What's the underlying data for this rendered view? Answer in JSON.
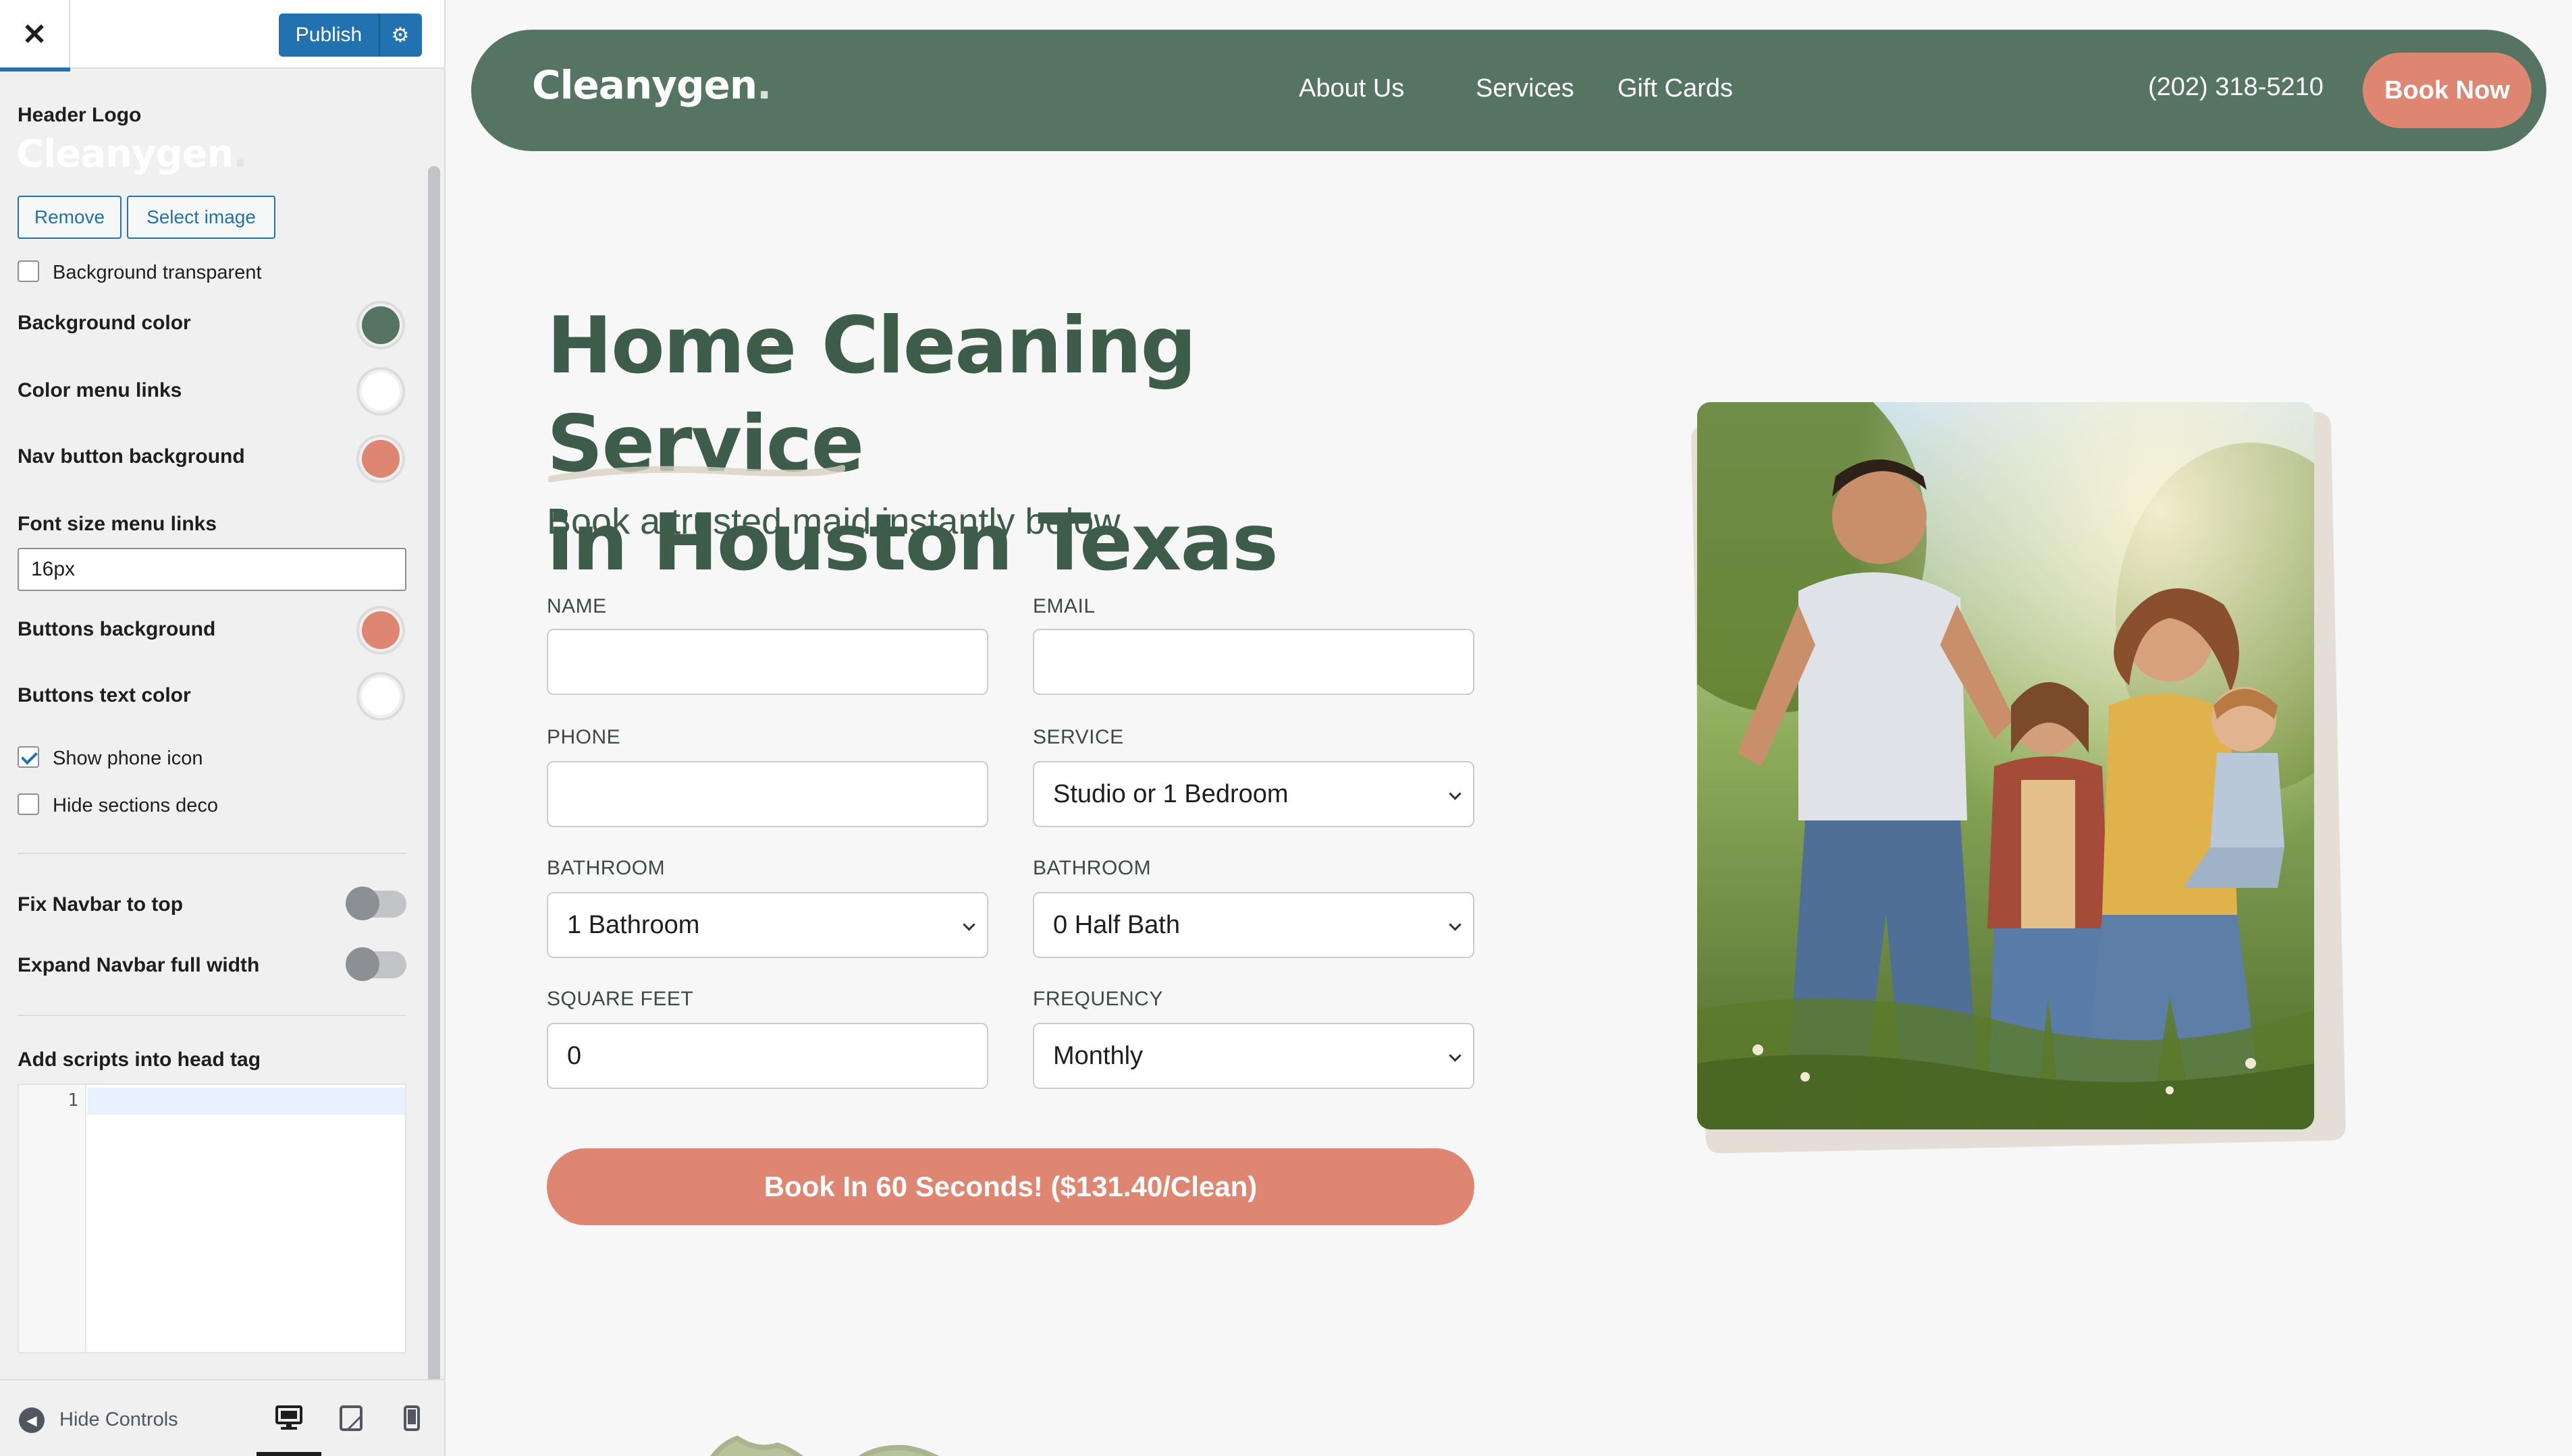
{
  "customizer": {
    "publish_label": "Publish",
    "header_logo_label": "Header Logo",
    "logo_text": "Cleanygen",
    "logo_dot": ".",
    "remove_label": "Remove",
    "select_image_label": "Select image",
    "bg_transparent_label": "Background transparent",
    "settings": {
      "background_color_label": "Background color",
      "color_menu_links_label": "Color menu links",
      "nav_button_bg_label": "Nav button background",
      "font_size_label": "Font size menu links",
      "font_size_value": "16px",
      "buttons_bg_label": "Buttons background",
      "buttons_text_color_label": "Buttons text color"
    },
    "show_phone_icon_label": "Show phone icon",
    "hide_sections_deco_label": "Hide sections deco",
    "fix_navbar_label": "Fix Navbar to top",
    "expand_navbar_label": "Expand Navbar full width",
    "scripts_label": "Add scripts into head tag",
    "code_line_number": "1",
    "hide_controls_label": "Hide Controls",
    "colors": {
      "background": "#557562",
      "menu_links": "#ffffff",
      "nav_button": "#de8672",
      "buttons_bg": "#de8672",
      "buttons_text": "#ffffff"
    }
  },
  "site": {
    "logo_text": "Cleanygen",
    "logo_dot": ".",
    "nav": [
      "About Us",
      "Services",
      "Gift Cards"
    ],
    "phone": "(202) 318-5210",
    "book_now": "Book Now",
    "hero_title_line1": "Home Cleaning Service",
    "hero_title_line2": "in Houston Texas",
    "hero_subtitle": "Book a trusted maid instantly below",
    "form": {
      "name_label": "NAME",
      "email_label": "EMAIL",
      "phone_label": "PHONE",
      "service_label": "SERVICE",
      "service_value": "Studio or 1 Bedroom",
      "bathroom_label": "BATHROOM",
      "bathroom_value": "1 Bathroom",
      "half_bath_label": "BATHROOM",
      "half_bath_value": "0 Half Bath",
      "sqft_label": "SQUARE FEET",
      "sqft_value": "0",
      "frequency_label": "FREQUENCY",
      "frequency_value": "Monthly"
    },
    "cta": "Book In 60 Seconds! ($131.40/Clean)",
    "colors": {
      "brand_green": "#557562",
      "heading_green": "#3d5c4a",
      "accent_salmon": "#de8672"
    }
  }
}
